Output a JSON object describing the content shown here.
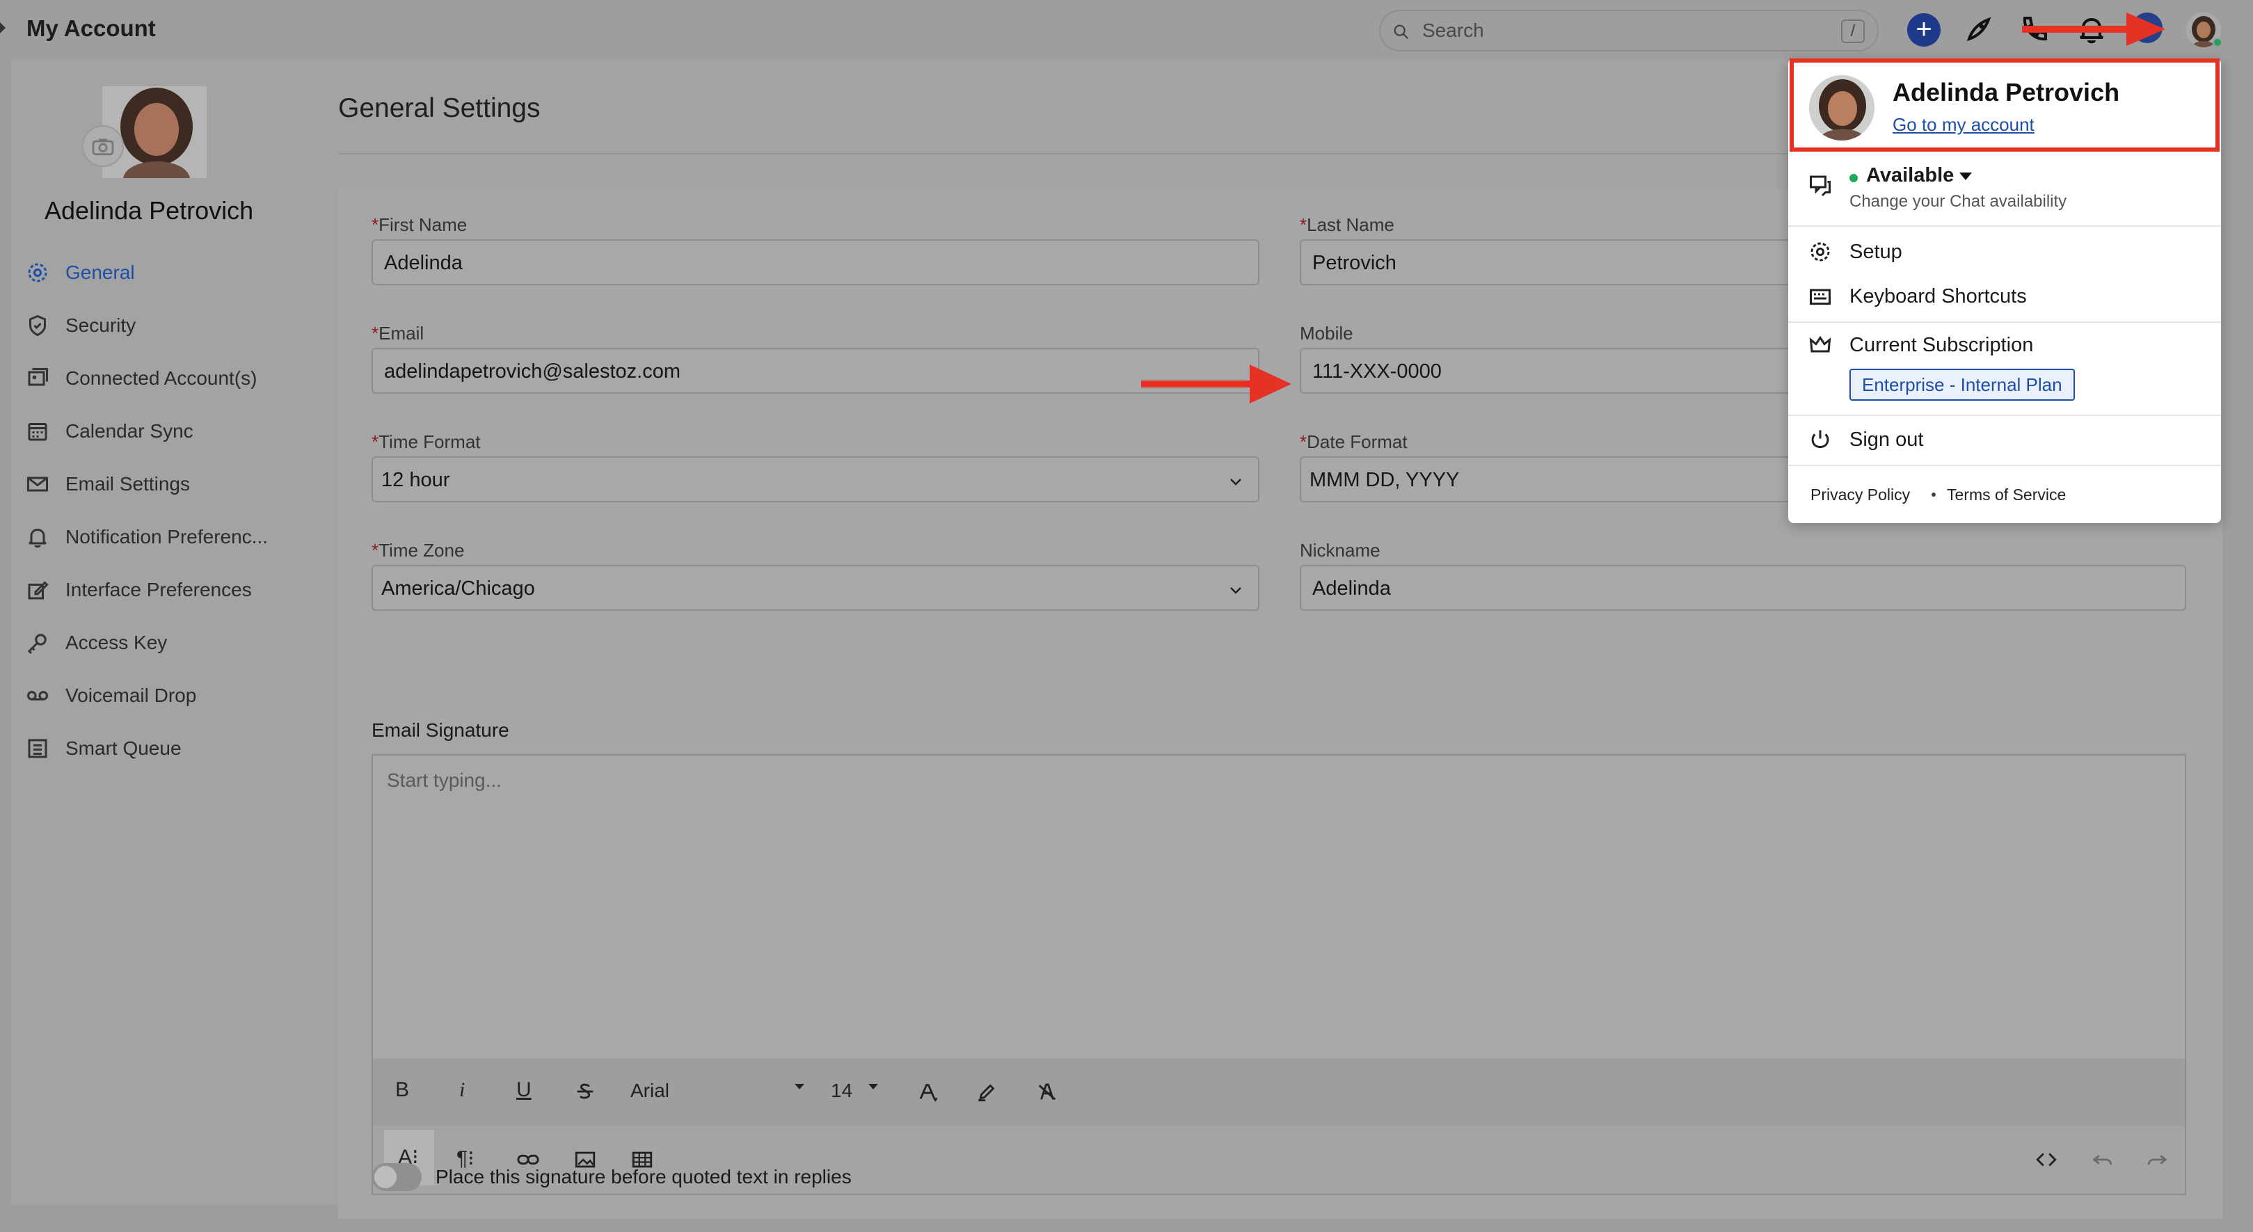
{
  "page": {
    "title": "My Account"
  },
  "search": {
    "placeholder": "Search",
    "shortcut": "/"
  },
  "topbar": {
    "add_label": "+"
  },
  "profile": {
    "name": "Adelinda Petrovich"
  },
  "sidebar": {
    "items": [
      {
        "label": "General",
        "icon": "gear-icon",
        "active": true
      },
      {
        "label": "Security",
        "icon": "shield-icon"
      },
      {
        "label": "Connected Account(s)",
        "icon": "connected-accounts-icon"
      },
      {
        "label": "Calendar Sync",
        "icon": "calendar-icon"
      },
      {
        "label": "Email Settings",
        "icon": "envelope-icon"
      },
      {
        "label": "Notification Preferenc...",
        "icon": "bell-icon"
      },
      {
        "label": "Interface Preferences",
        "icon": "edit-icon"
      },
      {
        "label": "Access Key",
        "icon": "key-icon"
      },
      {
        "label": "Voicemail Drop",
        "icon": "voicemail-icon"
      },
      {
        "label": "Smart Queue",
        "icon": "list-icon"
      }
    ]
  },
  "general": {
    "title": "General Settings",
    "required_mark": "*",
    "first_name": {
      "label": "First Name",
      "value": "Adelinda"
    },
    "last_name": {
      "label": "Last Name",
      "value": "Petrovich"
    },
    "email": {
      "label": "Email",
      "value": "adelindapetrovich@salestoz.com"
    },
    "mobile": {
      "label": "Mobile",
      "value": "111-XXX-0000"
    },
    "time_format": {
      "label": "Time Format",
      "value": "12 hour"
    },
    "date_format": {
      "label": "Date Format",
      "value": "MMM DD, YYYY"
    },
    "time_zone": {
      "label": "Time Zone",
      "value": "America/Chicago"
    },
    "nickname": {
      "label": "Nickname",
      "value": "Adelinda"
    },
    "signature": {
      "label": "Email Signature",
      "placeholder": "Start typing...",
      "font": "Arial",
      "font_size": "14",
      "bold": "B",
      "italic": "i",
      "underline": "U",
      "ai": "A⁝",
      "paragraph": "¶⁝"
    },
    "toggle_label": "Place this signature before quoted text in replies"
  },
  "menu": {
    "name": "Adelinda Petrovich",
    "link": "Go to my account",
    "status": "Available",
    "status_sub": "Change your Chat availability",
    "setup": "Setup",
    "shortcuts": "Keyboard Shortcuts",
    "subscription": "Current Subscription",
    "plan": "Enterprise - Internal Plan",
    "signout": "Sign out",
    "privacy": "Privacy Policy",
    "terms": "Terms of Service"
  },
  "colors": {
    "accent": "#1d4fa6",
    "highlight_red": "#e53224",
    "online_green": "#1fa85b"
  }
}
